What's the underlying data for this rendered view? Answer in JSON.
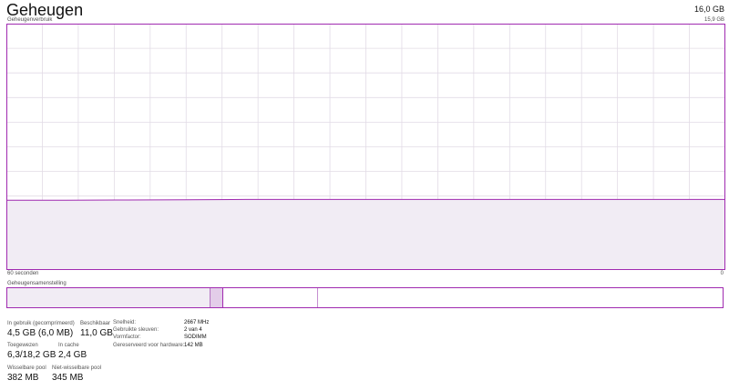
{
  "header": {
    "title": "Geheugen",
    "total": "16,0 GB"
  },
  "usage_graph": {
    "label": "Geheugenverbruik",
    "max_label": "15,9 GB",
    "time_left": "60 seconden",
    "time_right": "0"
  },
  "composition": {
    "label": "Geheugensamenstelling",
    "in_use_gb": 4.5,
    "modified_gb": 0.3,
    "standby_gb": 2.1,
    "free_gb": 8.9,
    "total_gb": 15.9
  },
  "stats": {
    "in_use_label": "In gebruik (gecomprimeerd)",
    "in_use_value": "4,5 GB (6,0 MB)",
    "available_label": "Beschikbaar",
    "available_value": "11,0 GB",
    "committed_label": "Toegewezen",
    "committed_value": "6,3/18,2 GB",
    "cached_label": "In cache",
    "cached_value": "2,4 GB",
    "paged_pool_label": "Wisselbare pool",
    "paged_pool_value": "382 MB",
    "nonpaged_pool_label": "Niet-wisselbare pool",
    "nonpaged_pool_value": "345 MB"
  },
  "hardware": {
    "speed_label": "Snelheid:",
    "speed_value": "2667 MHz",
    "slots_label": "Gebruikte sleuven:",
    "slots_value": "2 van 4",
    "form_label": "Vormfactor:",
    "form_value": "SODIMM",
    "reserved_label": "Gereserveerd voor hardware:",
    "reserved_value": "142 MB"
  },
  "colors": {
    "accent": "#a02ab0",
    "fill": "#f1ecf4",
    "grid": "#e2dbe6"
  },
  "chart_data": {
    "type": "area",
    "ylim": [
      0,
      15.9
    ],
    "x": [
      60,
      55,
      50,
      45,
      40,
      35,
      30,
      25,
      20,
      15,
      10,
      5,
      0
    ],
    "series": [
      {
        "values": [
          4.5,
          4.5,
          4.52,
          4.53,
          4.55,
          4.55,
          4.55,
          4.55,
          4.55,
          4.55,
          4.55,
          4.55,
          4.55
        ]
      }
    ]
  }
}
